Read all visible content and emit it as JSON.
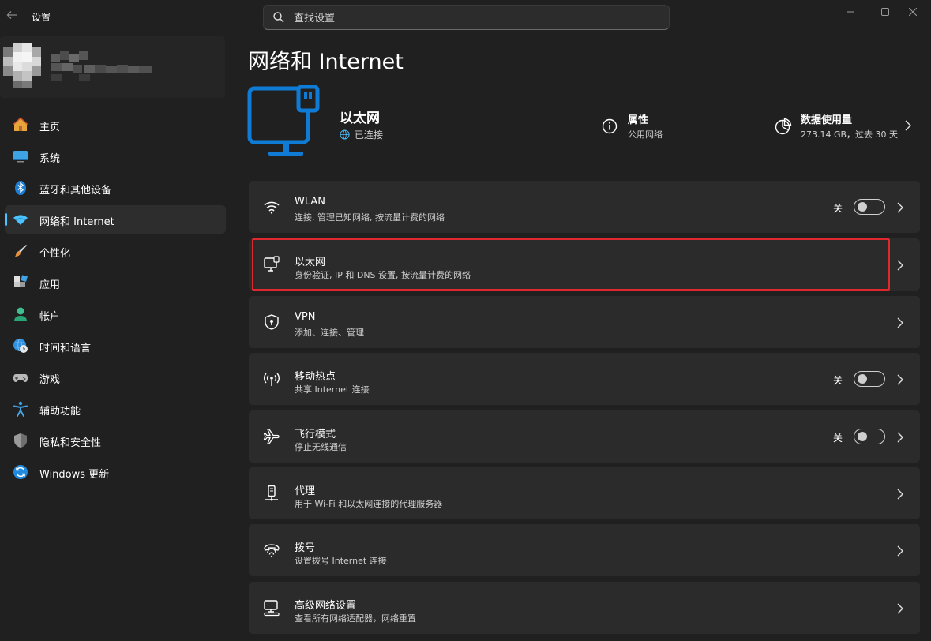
{
  "window": {
    "title": "设置"
  },
  "search": {
    "placeholder": "查找设置"
  },
  "sidebar": {
    "items": [
      {
        "label": "主页",
        "icon": "home-icon"
      },
      {
        "label": "系统",
        "icon": "display-icon"
      },
      {
        "label": "蓝牙和其他设备",
        "icon": "bluetooth-icon"
      },
      {
        "label": "网络和 Internet",
        "icon": "wifi-icon",
        "active": true
      },
      {
        "label": "个性化",
        "icon": "brush-icon"
      },
      {
        "label": "应用",
        "icon": "apps-icon"
      },
      {
        "label": "帐户",
        "icon": "person-icon"
      },
      {
        "label": "时间和语言",
        "icon": "globe-clock-icon"
      },
      {
        "label": "游戏",
        "icon": "gamepad-icon"
      },
      {
        "label": "辅助功能",
        "icon": "accessibility-icon"
      },
      {
        "label": "隐私和安全性",
        "icon": "shield-icon"
      },
      {
        "label": "Windows 更新",
        "icon": "update-icon"
      }
    ]
  },
  "main": {
    "title": "网络和 Internet",
    "hero": {
      "name": "以太网",
      "status": "已连接",
      "properties_title": "属性",
      "properties_sub": "公用网络",
      "usage_title": "数据使用量",
      "usage_sub": "273.14 GB，过去 30 天"
    },
    "cards": [
      {
        "title": "WLAN",
        "subtitle": "连接, 管理已知网络, 按流量计费的网络",
        "icon": "wifi-icon",
        "toggle_label": "关",
        "toggle_on": false
      },
      {
        "title": "以太网",
        "subtitle": "身份验证, IP 和 DNS 设置, 按流量计费的网络",
        "icon": "ethernet-icon",
        "highlighted": true
      },
      {
        "title": "VPN",
        "subtitle": "添加、连接、管理",
        "icon": "vpn-shield-icon"
      },
      {
        "title": "移动热点",
        "subtitle": "共享 Internet 连接",
        "icon": "hotspot-icon",
        "toggle_label": "关",
        "toggle_on": false
      },
      {
        "title": "飞行模式",
        "subtitle": "停止无线通信",
        "icon": "airplane-icon",
        "toggle_label": "关",
        "toggle_on": false
      },
      {
        "title": "代理",
        "subtitle": "用于 Wi-Fi 和以太网连接的代理服务器",
        "icon": "proxy-icon"
      },
      {
        "title": "拨号",
        "subtitle": "设置拨号 Internet 连接",
        "icon": "dialup-icon"
      },
      {
        "title": "高级网络设置",
        "subtitle": "查看所有网络适配器，网络重置",
        "icon": "advanced-network-icon"
      }
    ]
  },
  "colors": {
    "accent": "#4cc2ff",
    "highlight": "#e0282e",
    "ethernet_blue": "#0f7bd4"
  }
}
